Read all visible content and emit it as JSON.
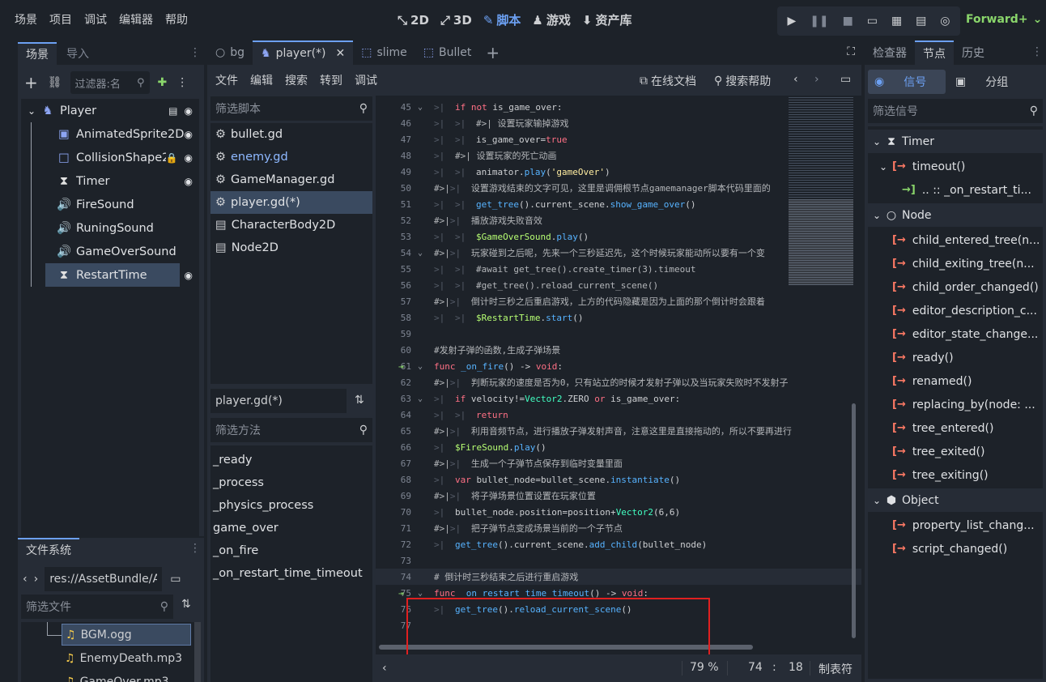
{
  "menu": [
    "场景",
    "项目",
    "调试",
    "编辑器",
    "帮助"
  ],
  "workspaces": [
    {
      "icon": "2d-icon",
      "glyph": "⤡",
      "label": "2D"
    },
    {
      "icon": "3d-icon",
      "glyph": "⤢",
      "label": "3D"
    },
    {
      "icon": "script-icon",
      "glyph": "✎",
      "label": "脚本"
    },
    {
      "icon": "game-icon",
      "glyph": "♟",
      "label": "游戏"
    },
    {
      "icon": "assetlib-icon",
      "glyph": "⬇",
      "label": "资产库"
    }
  ],
  "renderer": "Forward+",
  "scene_dock": {
    "tabs": [
      "场景",
      "导入"
    ],
    "filter_placeholder": "过滤器:名",
    "nodes": [
      {
        "name": "Player",
        "icon": "character-icon",
        "glyph": "♞",
        "color": "#8da5f3",
        "depth": 0,
        "badges": [
          "script-badge",
          "visible-badge"
        ]
      },
      {
        "name": "AnimatedSprite2D",
        "icon": "sprite-icon",
        "glyph": "▣",
        "color": "#8da5f3",
        "depth": 1,
        "badges": [
          "visible-badge"
        ]
      },
      {
        "name": "CollisionShape2",
        "icon": "collision-icon",
        "glyph": "□",
        "color": "#8da5f3",
        "depth": 1,
        "badges": [
          "lock-badge",
          "visible-badge"
        ]
      },
      {
        "name": "Timer",
        "icon": "timer-icon",
        "glyph": "⧗",
        "color": "#e0e0e0",
        "depth": 1,
        "badges": [
          "signal-badge"
        ]
      },
      {
        "name": "FireSound",
        "icon": "audio-icon",
        "glyph": "🔊",
        "color": "#e0e0e0",
        "depth": 1,
        "badges": []
      },
      {
        "name": "RuningSound",
        "icon": "audio-icon",
        "glyph": "🔊",
        "color": "#e0e0e0",
        "depth": 1,
        "badges": []
      },
      {
        "name": "GameOverSound",
        "icon": "audio-icon",
        "glyph": "🔊",
        "color": "#e0e0e0",
        "depth": 1,
        "badges": []
      },
      {
        "name": "RestartTime",
        "icon": "timer-icon",
        "glyph": "⧗",
        "color": "#e0e0e0",
        "depth": 1,
        "badges": [
          "signal-badge"
        ],
        "selected": true
      }
    ]
  },
  "filesystem": {
    "title": "文件系统",
    "path": "res://AssetBundle/A",
    "filter_placeholder": "筛选文件",
    "files": [
      "BGM.ogg",
      "EnemyDeath.mp3",
      "GameOver.mp3"
    ]
  },
  "script_tabs": [
    {
      "label": "bg",
      "icon": "node-icon",
      "active": false
    },
    {
      "label": "player(*)",
      "icon": "character-icon",
      "active": true
    },
    {
      "label": "slime",
      "icon": "scene-icon",
      "active": false
    },
    {
      "label": "Bullet",
      "icon": "scene-icon",
      "active": false
    }
  ],
  "script_menu": [
    "文件",
    "编辑",
    "搜索",
    "转到",
    "调试"
  ],
  "script_help": {
    "online_docs": "在线文档",
    "search_help": "搜索帮助"
  },
  "script_list": {
    "filter_placeholder": "筛选脚本",
    "items": [
      {
        "label": "bullet.gd",
        "icon": "gear-icon",
        "color": "#dfe1e4"
      },
      {
        "label": "enemy.gd",
        "icon": "gear-icon",
        "color": "#8eb8ff"
      },
      {
        "label": "GameManager.gd",
        "icon": "gear-icon",
        "color": "#dfe1e4"
      },
      {
        "label": "player.gd(*)",
        "icon": "gear-icon",
        "color": "#dfe1e4",
        "selected": true
      },
      {
        "label": "CharacterBody2D",
        "icon": "doc-icon",
        "color": "#dfe1e4"
      },
      {
        "label": "Node2D",
        "icon": "doc-icon",
        "color": "#dfe1e4"
      }
    ],
    "current": "player.gd(*)",
    "method_filter_placeholder": "筛选方法",
    "methods": [
      "_ready",
      "_process",
      "_physics_process",
      "game_over",
      "_on_fire",
      "_on_restart_time_timeout"
    ]
  },
  "code_lines": [
    {
      "n": 45,
      "fold": true,
      "html": "<span class='tabchar'>&gt;|</span><span class='kw'>if not</span> is_game_over:"
    },
    {
      "n": 46,
      "html": "<span class='tabchar'>&gt;|</span><span class='tabchar'>&gt;|</span><span class='cm'>#&gt;|  设置玩家输掉游戏</span>"
    },
    {
      "n": 47,
      "html": "<span class='tabchar'>&gt;|</span><span class='tabchar'>&gt;|</span>is_game_over=<span class='kw'>true</span>"
    },
    {
      "n": 48,
      "html": "<span class='tabchar'>&gt;|</span><span class='cm'>#&gt;|  设置玩家的死亡动画</span>"
    },
    {
      "n": 49,
      "html": "<span class='tabchar'>&gt;|</span><span class='tabchar'>&gt;|</span>animator.<span class='fn'>play</span>(<span class='str'>'gameOver'</span>)"
    },
    {
      "n": 50,
      "html": "<span class='cm'>#&gt;|</span><span class='tabchar'>&gt;|</span><span class='cm'>设置游戏结束的文字可见，这里是调佣根节点gamemanager脚本代码里面的</span>"
    },
    {
      "n": 51,
      "html": "<span class='tabchar'>&gt;|</span><span class='tabchar'>&gt;|</span><span class='fn'>get_tree</span>().current_scene.<span class='fn'>show_game_over</span>()"
    },
    {
      "n": 52,
      "html": "<span class='cm'>#&gt;|</span><span class='tabchar'>&gt;|</span><span class='cm'>播放游戏失败音效</span>"
    },
    {
      "n": 53,
      "html": "<span class='tabchar'>&gt;|</span><span class='tabchar'>&gt;|</span><span class='gr'>$GameOverSound</span>.<span class='fn'>play</span>()"
    },
    {
      "n": 54,
      "fold": true,
      "html": "<span class='cm'>#&gt;|</span><span class='tabchar'>&gt;|</span><span class='cm'>玩家碰到之后呢，先来一个三秒延迟先，这个时候玩家能动所以要有一个变</span>"
    },
    {
      "n": 55,
      "html": "<span class='tabchar'>&gt;|</span><span class='tabchar'>&gt;|</span><span class='cm'>#await get_tree().create_timer(3).timeout</span>"
    },
    {
      "n": 56,
      "html": "<span class='tabchar'>&gt;|</span><span class='tabchar'>&gt;|</span><span class='cm'>#get_tree().reload_current_scene()</span>"
    },
    {
      "n": 57,
      "html": "<span class='cm'>#&gt;|</span><span class='tabchar'>&gt;|</span><span class='cm'>倒计时三秒之后重启游戏，上方的代码隐藏是因为上面的那个倒计时会跟着</span>"
    },
    {
      "n": 58,
      "html": "<span class='tabchar'>&gt;|</span><span class='tabchar'>&gt;|</span><span class='gr'>$RestartTime</span>.<span class='fn'>start</span>()"
    },
    {
      "n": 59,
      "html": ""
    },
    {
      "n": 60,
      "html": "<span class='cm'>#发射子弹的函数,生成子弹场景</span>"
    },
    {
      "n": 61,
      "fold": true,
      "arrow": true,
      "html": "<span class='kw'>func</span> <span class='fn'>_on_fire</span>() -&gt; <span class='kw'>void</span>:"
    },
    {
      "n": 62,
      "html": "<span class='cm'>#&gt;|</span><span class='tabchar'>&gt;|</span><span class='cm'>判断玩家的速度是否为0，只有站立的时候才发射子弹以及当玩家失败时不发射子</span>"
    },
    {
      "n": 63,
      "fold": true,
      "html": "<span class='tabchar'>&gt;|</span><span class='kw'>if</span> velocity!=<span class='ty'>Vector2</span>.ZERO <span class='kw'>or</span> is_game_over:"
    },
    {
      "n": 64,
      "html": "<span class='tabchar'>&gt;|</span><span class='tabchar'>&gt;|</span><span class='kw'>return</span>"
    },
    {
      "n": 65,
      "html": "<span class='cm'>#&gt;|</span><span class='tabchar'>&gt;|</span><span class='cm'>利用音频节点，进行播放子弹发射声音，注意这里是直接拖动的，所以不要再进行</span>"
    },
    {
      "n": 66,
      "html": "<span class='tabchar'>&gt;|</span><span class='gr'>$FireSound</span>.<span class='fn'>play</span>()"
    },
    {
      "n": 67,
      "html": "<span class='cm'>#&gt;|</span><span class='tabchar'>&gt;|</span><span class='cm'>生成一个子弹节点保存到临时变量里面</span>"
    },
    {
      "n": 68,
      "html": "<span class='tabchar'>&gt;|</span><span class='kw'>var</span> bullet_node=bullet_scene.<span class='fn'>instantiate</span>()"
    },
    {
      "n": 69,
      "html": "<span class='cm'>#&gt;|</span><span class='tabchar'>&gt;|</span><span class='cm'>将子弹场景位置设置在玩家位置</span>"
    },
    {
      "n": 70,
      "html": "<span class='tabchar'>&gt;|</span>bullet_node.position=position+<span class='ty'>Vector2</span>(6,6)"
    },
    {
      "n": 71,
      "html": "<span class='cm'>#&gt;|</span><span class='tabchar'>&gt;|</span><span class='cm'>把子弹节点变成场景当前的一个子节点</span>"
    },
    {
      "n": 72,
      "html": "<span class='tabchar'>&gt;|</span><span class='fn'>get_tree</span>().current_scene.<span class='fn'>add_child</span>(bullet_node)"
    },
    {
      "n": 73,
      "html": ""
    },
    {
      "n": 74,
      "current": true,
      "html": "<span class='cm'># 倒计时三秒结束之后进行重启游戏</span>"
    },
    {
      "n": 75,
      "fold": true,
      "arrow": true,
      "html": "<span class='kw'>func</span> <span class='fn'>_on_restart_time_timeout</span>() -&gt; <span class='kw'>void</span>:"
    },
    {
      "n": 76,
      "html": "<span class='tabchar'>&gt;|</span><span class='fn'>get_tree</span>().<span class='fn'>reload_current_scene</span>()"
    },
    {
      "n": 77,
      "html": ""
    }
  ],
  "status": {
    "zoom": "79 %",
    "line": "74",
    "sep": ":",
    "col": "18",
    "indent": "制表符"
  },
  "node_dock": {
    "tabs": [
      "检查器",
      "节点",
      "历史"
    ],
    "sub_tabs": [
      "信号",
      "分组"
    ],
    "filter_placeholder": "筛选信号",
    "groups": [
      {
        "name": "Timer",
        "icon": "timer-icon",
        "glyph": "⧗",
        "signals": [
          {
            "label": "timeout()",
            "connections": [
              ".. :: _on_restart_ti..."
            ]
          }
        ]
      },
      {
        "name": "Node",
        "icon": "node-icon",
        "glyph": "○",
        "signals": [
          {
            "label": "child_entered_tree(n..."
          },
          {
            "label": "child_exiting_tree(n..."
          },
          {
            "label": "child_order_changed()"
          },
          {
            "label": "editor_description_c..."
          },
          {
            "label": "editor_state_change..."
          },
          {
            "label": "ready()"
          },
          {
            "label": "renamed()"
          },
          {
            "label": "replacing_by(node: ..."
          },
          {
            "label": "tree_entered()"
          },
          {
            "label": "tree_exited()"
          },
          {
            "label": "tree_exiting()"
          }
        ]
      },
      {
        "name": "Object",
        "icon": "object-icon",
        "glyph": "⬢",
        "signals": [
          {
            "label": "property_list_chang..."
          },
          {
            "label": "script_changed()"
          }
        ]
      }
    ]
  },
  "colors": {
    "accent": "#6ca0f2",
    "highlight": "#e02020",
    "bg": "#1d2229",
    "panel": "#262c36"
  }
}
